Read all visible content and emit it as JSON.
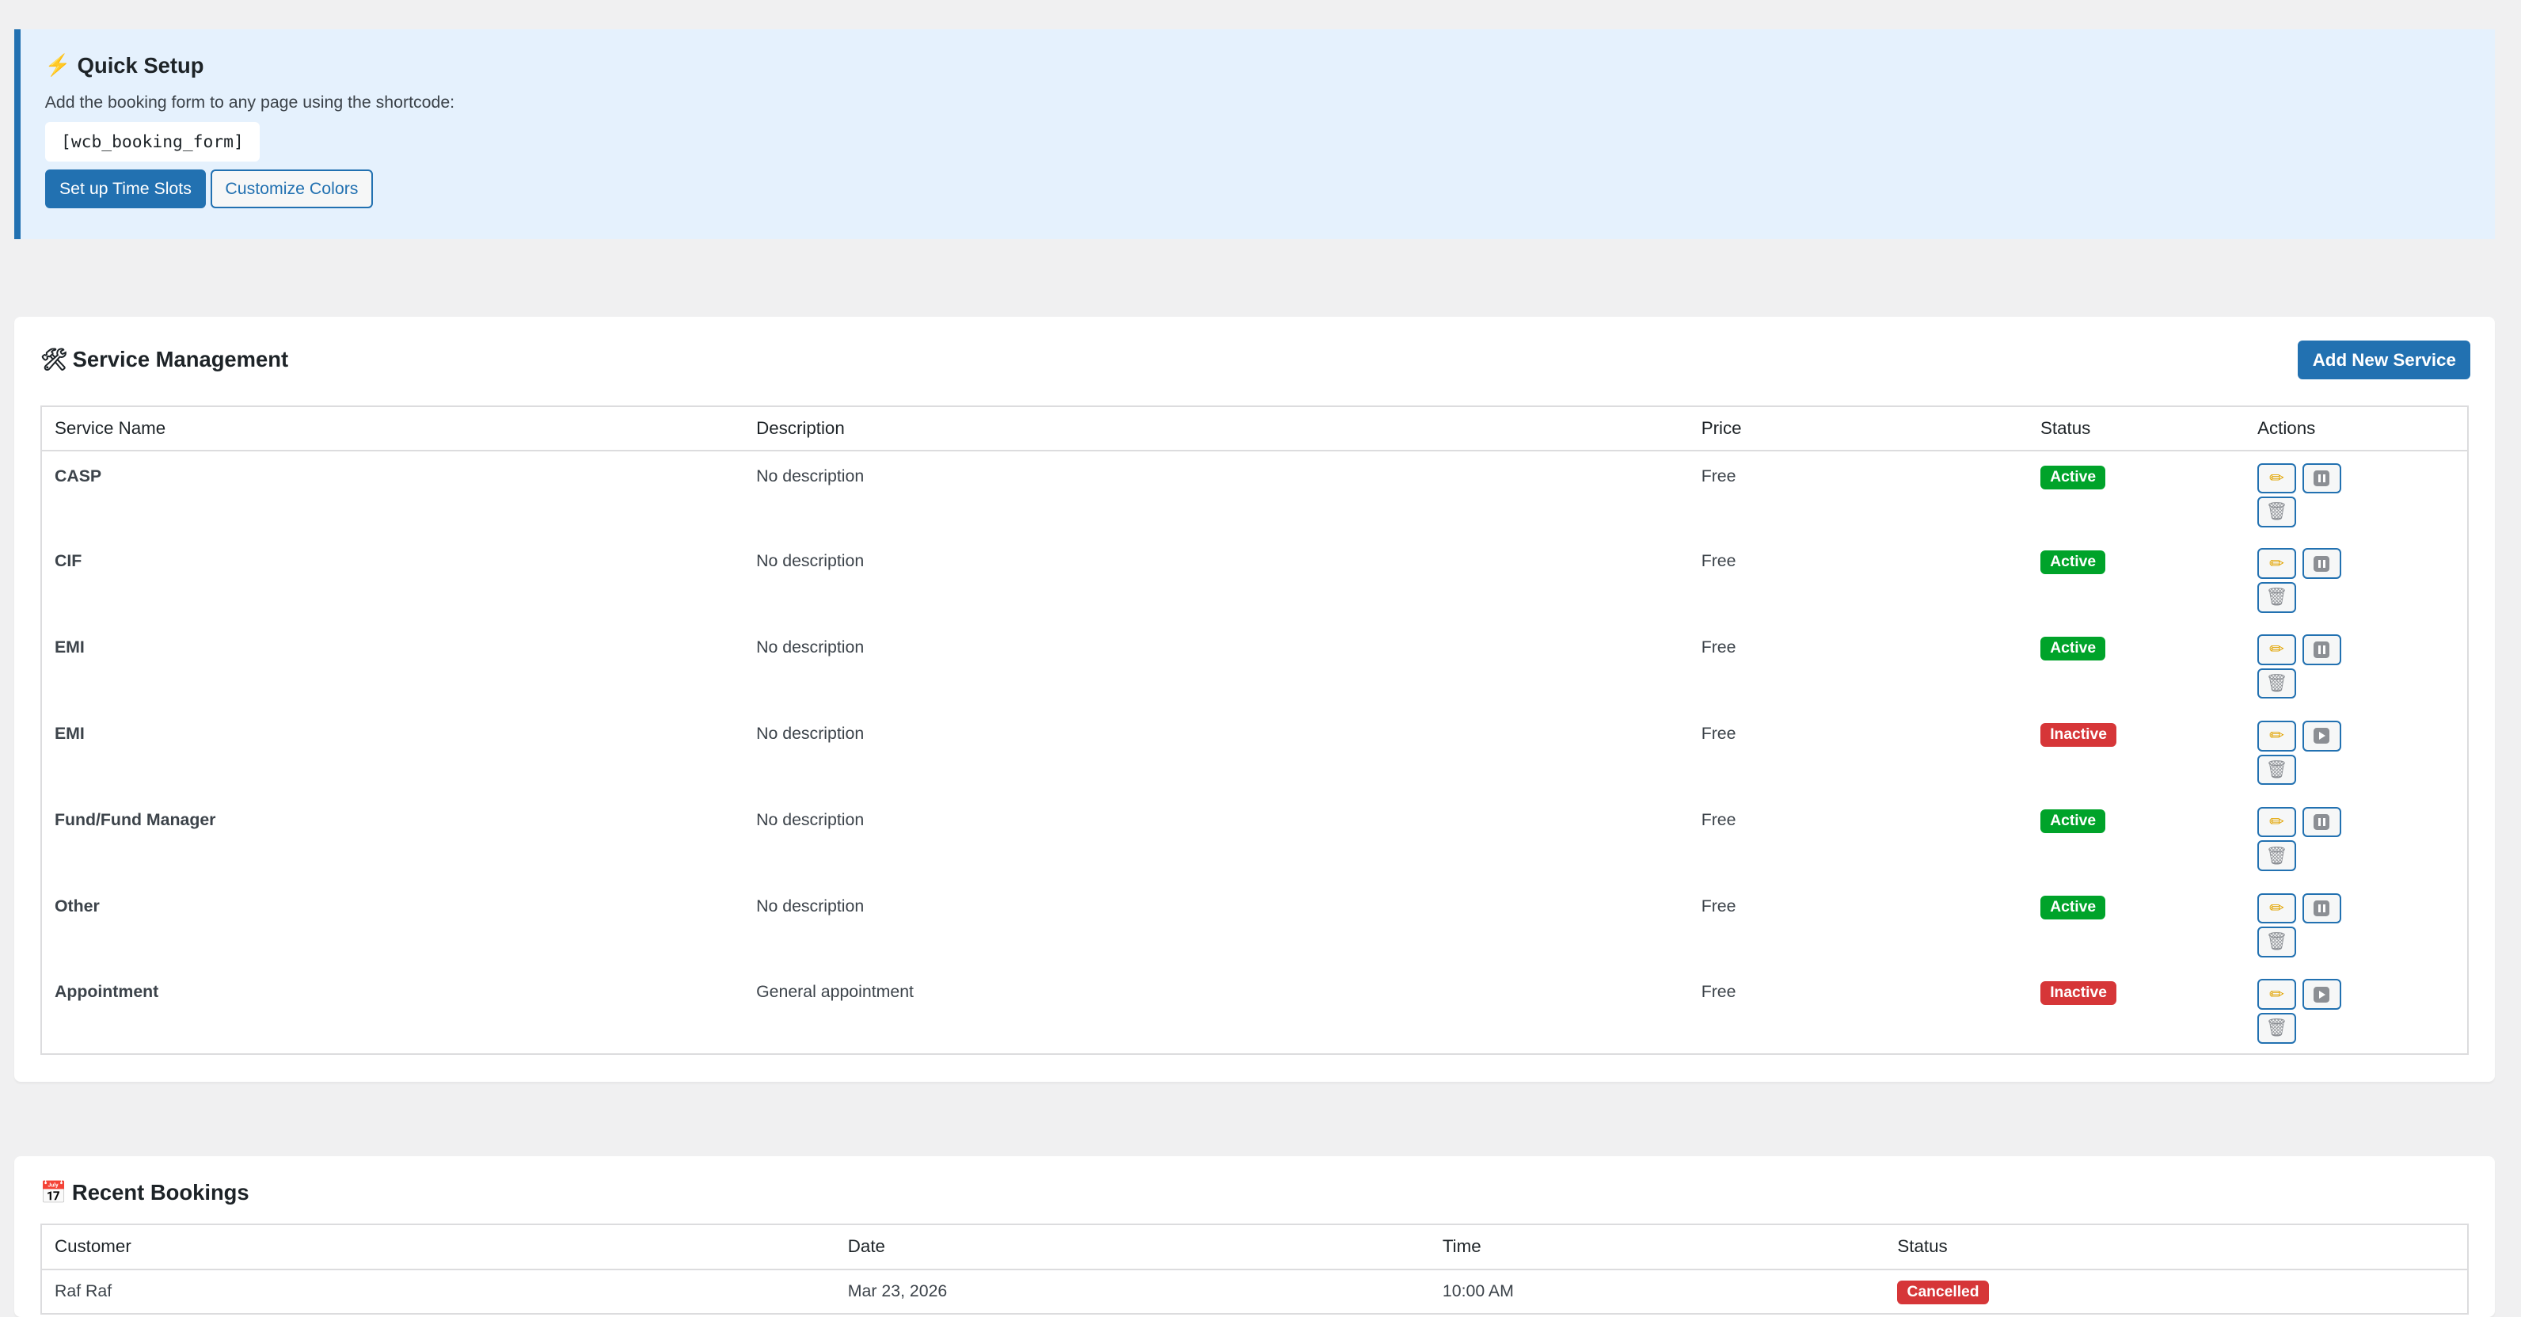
{
  "quick_setup": {
    "icon": "lightning-icon",
    "title": "Quick Setup",
    "description": "Add the booking form to any page using the shortcode:",
    "shortcode": "[wcb_booking_form]",
    "primary_button": "Set up Time Slots",
    "secondary_button": "Customize Colors"
  },
  "services": {
    "icon": "tools-icon",
    "title": "Service Management",
    "add_button": "Add New Service",
    "columns": [
      "Service Name",
      "Description",
      "Price",
      "Status",
      "Actions"
    ],
    "rows": [
      {
        "name": "CASP",
        "description": "No description",
        "price": "Free",
        "status": "Active"
      },
      {
        "name": "CIF",
        "description": "No description",
        "price": "Free",
        "status": "Active"
      },
      {
        "name": "EMI",
        "description": "No description",
        "price": "Free",
        "status": "Active"
      },
      {
        "name": "EMI",
        "description": "No description",
        "price": "Free",
        "status": "Inactive"
      },
      {
        "name": "Fund/Fund Manager",
        "description": "No description",
        "price": "Free",
        "status": "Active"
      },
      {
        "name": "Other",
        "description": "No description",
        "price": "Free",
        "status": "Active"
      },
      {
        "name": "Appointment",
        "description": "General appointment",
        "price": "Free",
        "status": "Inactive"
      }
    ]
  },
  "bookings": {
    "icon": "calendar-icon",
    "title": "Recent Bookings",
    "columns": [
      "Customer",
      "Date",
      "Time",
      "Status"
    ],
    "rows": [
      {
        "customer": "Raf Raf",
        "date": "Mar 23, 2026",
        "time": "10:00 AM",
        "status": "Cancelled"
      }
    ]
  },
  "colors": {
    "primary": "#2271b1",
    "active": "#00a32a",
    "inactive": "#d63638",
    "notice_bg": "#e5f1fd"
  }
}
